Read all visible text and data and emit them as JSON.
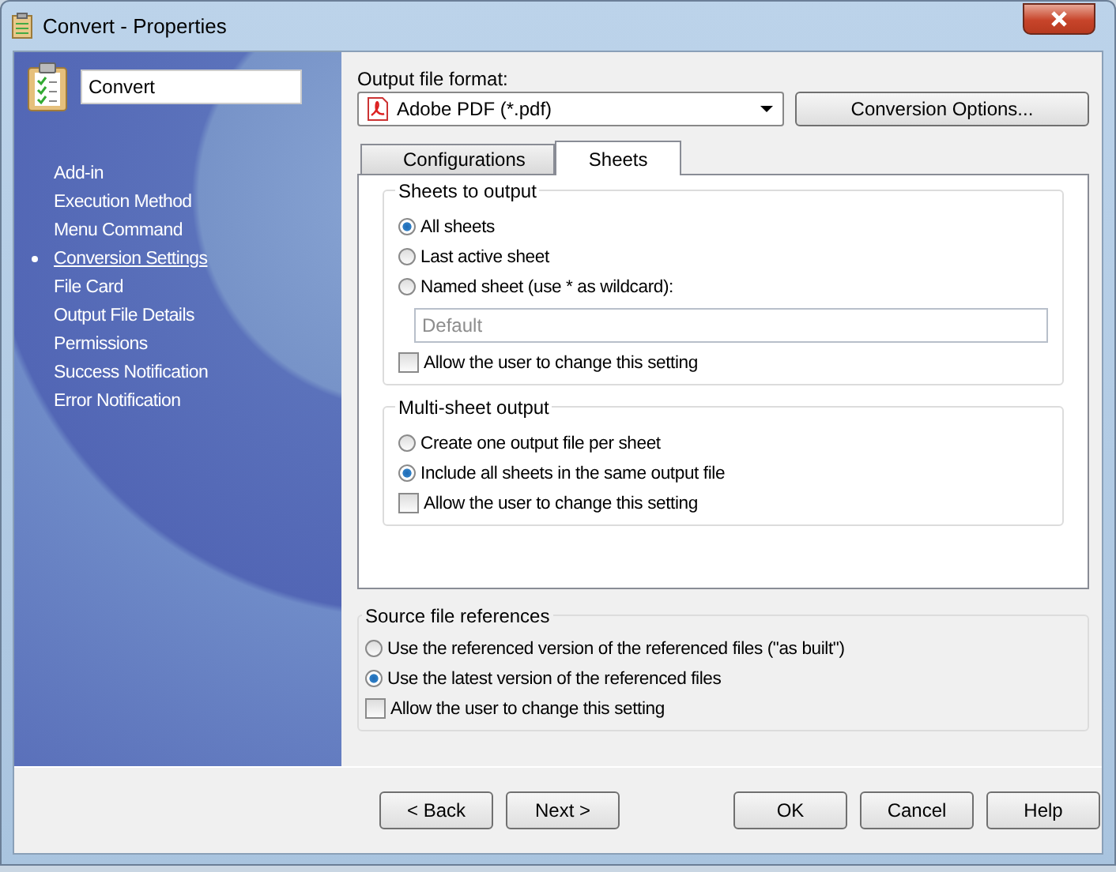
{
  "window": {
    "title": "Convert - Properties"
  },
  "name_field": {
    "value": "Convert"
  },
  "nav": [
    {
      "label": "Add-in",
      "selected": false
    },
    {
      "label": "Execution Method",
      "selected": false
    },
    {
      "label": "Menu Command",
      "selected": false
    },
    {
      "label": "Conversion Settings",
      "selected": true
    },
    {
      "label": "File Card",
      "selected": false
    },
    {
      "label": "Output File Details",
      "selected": false
    },
    {
      "label": "Permissions",
      "selected": false
    },
    {
      "label": "Success Notification",
      "selected": false
    },
    {
      "label": "Error Notification",
      "selected": false
    }
  ],
  "output_format": {
    "label": "Output file format:",
    "value": "Adobe PDF (*.pdf)",
    "options_button": "Conversion Options..."
  },
  "tabs": [
    {
      "label": "Configurations",
      "selected": false
    },
    {
      "label": "Sheets",
      "selected": true
    }
  ],
  "tab_groups": [
    {
      "title": "Sheets to output",
      "options": [
        {
          "label": "All sheets",
          "selected": true
        },
        {
          "label": "Last active sheet",
          "selected": false
        },
        {
          "label": "Named sheet (use * as wildcard):",
          "selected": false
        }
      ],
      "field": {
        "placeholder": "Default"
      },
      "allow": {
        "label": "Allow the user to change this setting",
        "checked": false
      }
    },
    {
      "title": "Multi-sheet output",
      "options": [
        {
          "label": "Create one output file per sheet",
          "selected": false
        },
        {
          "label": "Include all sheets in the same output file",
          "selected": true
        }
      ],
      "allow": {
        "label": "Allow the user to change this setting",
        "checked": false
      }
    }
  ],
  "source_group": {
    "title": "Source file references",
    "options": [
      {
        "label": "Use the referenced version of the referenced files (\"as built\")",
        "selected": false
      },
      {
        "label": "Use the latest version of the referenced files",
        "selected": true
      }
    ],
    "allow": {
      "label": "Allow the user to change this setting",
      "checked": false
    }
  },
  "nav_buttons": [
    "< Back",
    "Next >"
  ],
  "action_buttons": [
    "OK",
    "Cancel",
    "Help"
  ]
}
